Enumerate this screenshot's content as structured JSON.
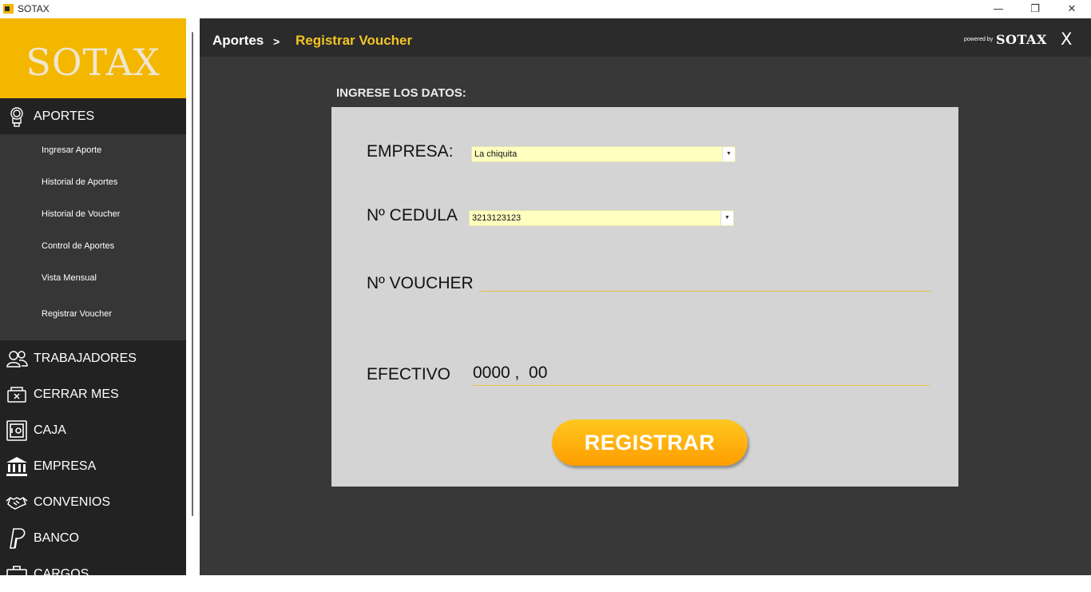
{
  "window": {
    "title": "SOTAX",
    "minimize_glyph": "—",
    "maximize_glyph": "❐",
    "close_glyph": "✕"
  },
  "sidebar": {
    "logo": "SOTAX",
    "sections": [
      {
        "label": "APORTES",
        "icon": "coins-icon"
      },
      {
        "label": "TRABAJADORES",
        "icon": "users-icon"
      },
      {
        "label": "CERRAR MES",
        "icon": "cash-register-icon"
      },
      {
        "label": "CAJA",
        "icon": "safe-icon"
      },
      {
        "label": "EMPRESA",
        "icon": "bank-icon"
      },
      {
        "label": "CONVENIOS",
        "icon": "handshake-icon"
      },
      {
        "label": "BANCO",
        "icon": "paypal-icon"
      },
      {
        "label": "CARGOS",
        "icon": "briefcase-icon"
      }
    ],
    "submenu": [
      "Ingresar Aporte",
      "Historial de Aportes",
      "Historial de Voucher",
      "Control de Aportes",
      "Vista Mensual",
      "Registrar Voucher"
    ]
  },
  "header": {
    "breadcrumb_root": "Aportes",
    "breadcrumb_sep": ">",
    "breadcrumb_current": "Registrar Voucher",
    "powered_by": "powered by",
    "powered_brand": "SOTAX",
    "close_label": "X"
  },
  "form": {
    "heading": "INGRESE LOS DATOS:",
    "empresa_label": "EMPRESA:",
    "empresa_value": "La chiquita",
    "cedula_label": "Nº CEDULA",
    "cedula_value": "3213123123",
    "voucher_label": "Nº VOUCHER",
    "voucher_value": "",
    "efectivo_label": "EFECTIVO",
    "efectivo_value": "0000 ,  00",
    "submit_label": "REGISTRAR"
  },
  "colors": {
    "accent": "#f3b700",
    "sidebar_bg": "#222222",
    "submenu_bg": "#363636",
    "main_bg": "#383838",
    "panel_bg": "#d4d4d4",
    "field_bg": "#ffffc0",
    "button_gradient_top": "#ffc820",
    "button_gradient_bottom": "#ff9d00"
  }
}
